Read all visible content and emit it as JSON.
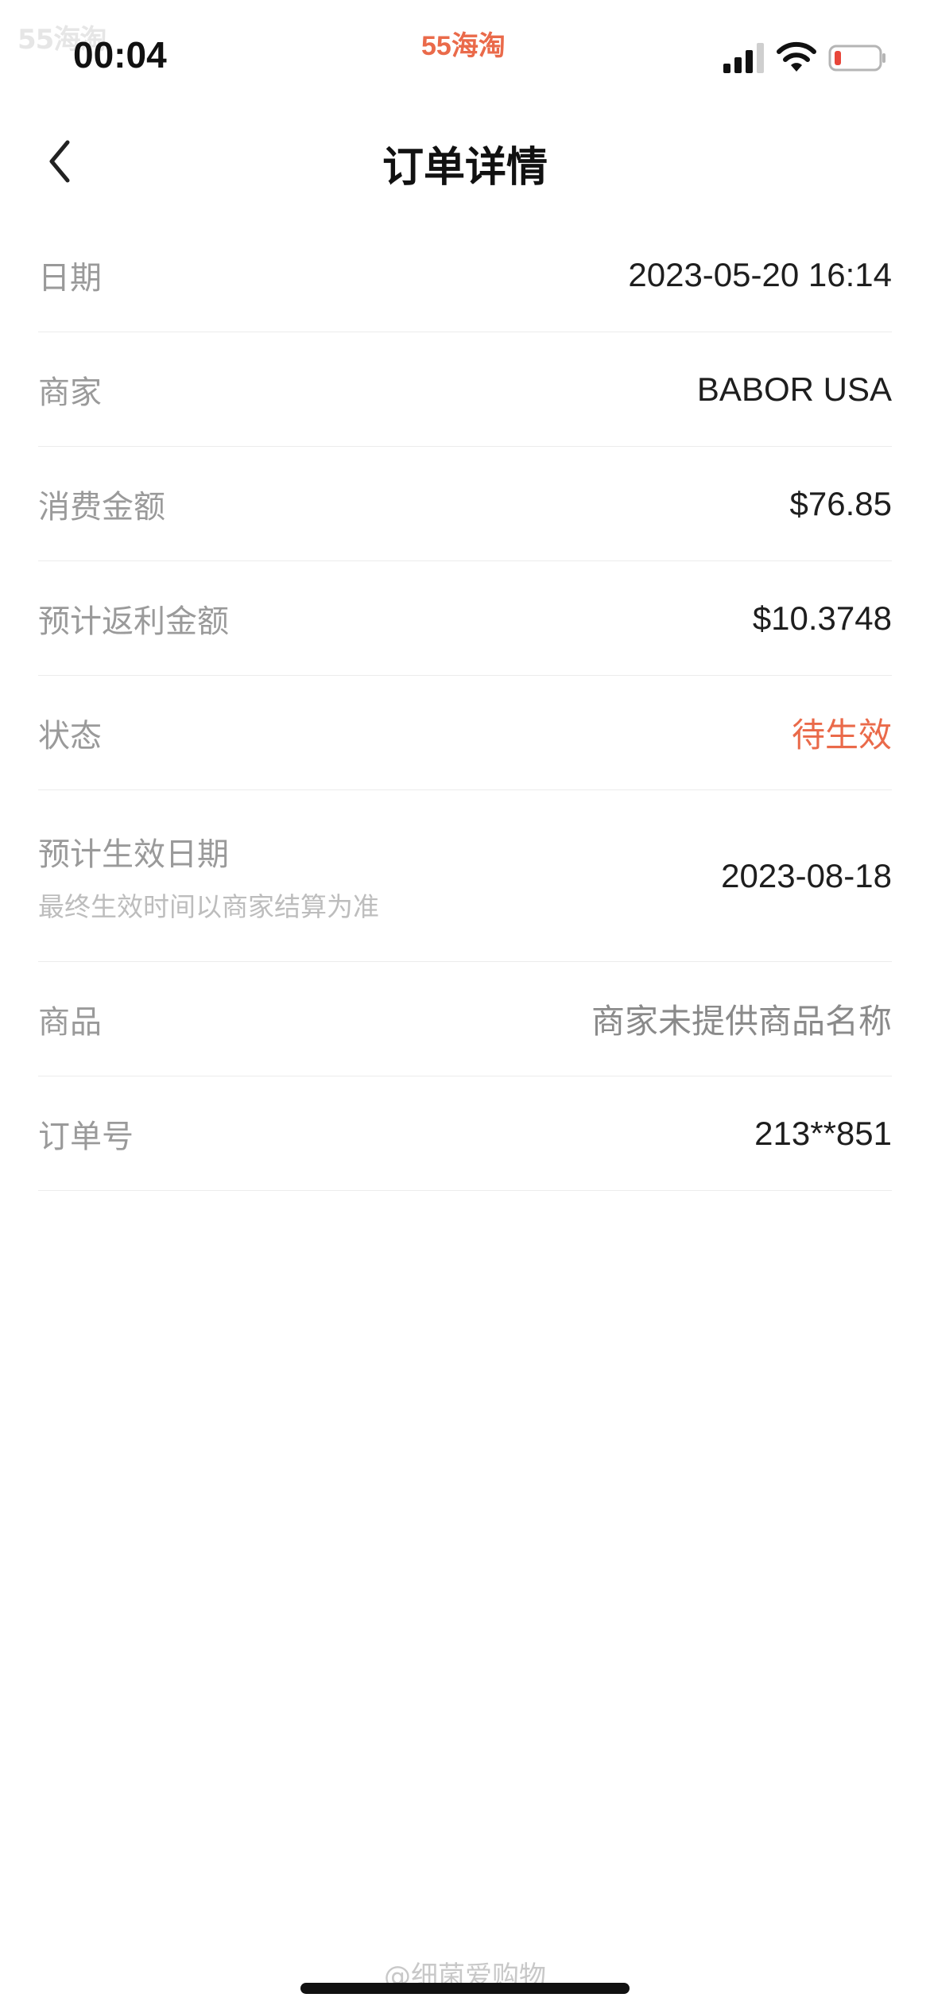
{
  "status_bar": {
    "watermark": "55海淘",
    "time": "00:04",
    "app_name": "55海淘",
    "icons": [
      "cellular-signal-icon",
      "wifi-icon",
      "battery-low-icon"
    ]
  },
  "nav": {
    "back_icon": "chevron-left-icon",
    "title": "订单详情"
  },
  "details": {
    "date": {
      "label": "日期",
      "value": "2023-05-20 16:14"
    },
    "merchant": {
      "label": "商家",
      "value": "BABOR USA"
    },
    "amount": {
      "label": "消费金额",
      "value": "$76.85"
    },
    "rebate": {
      "label": "预计返利金额",
      "value": "$10.3748"
    },
    "status": {
      "label": "状态",
      "value": "待生效"
    },
    "effective_date": {
      "label": "预计生效日期",
      "note": "最终生效时间以商家结算为准",
      "value": "2023-08-18"
    },
    "product": {
      "label": "商品",
      "value": "商家未提供商品名称"
    },
    "order_no": {
      "label": "订单号",
      "value": "213**851"
    }
  },
  "footer": {
    "watermark": "@细菌爱购物"
  },
  "colors": {
    "accent": "#ea6a4a",
    "label": "#9a9a9a",
    "value": "#1e1e1e",
    "divider": "#ececec"
  }
}
